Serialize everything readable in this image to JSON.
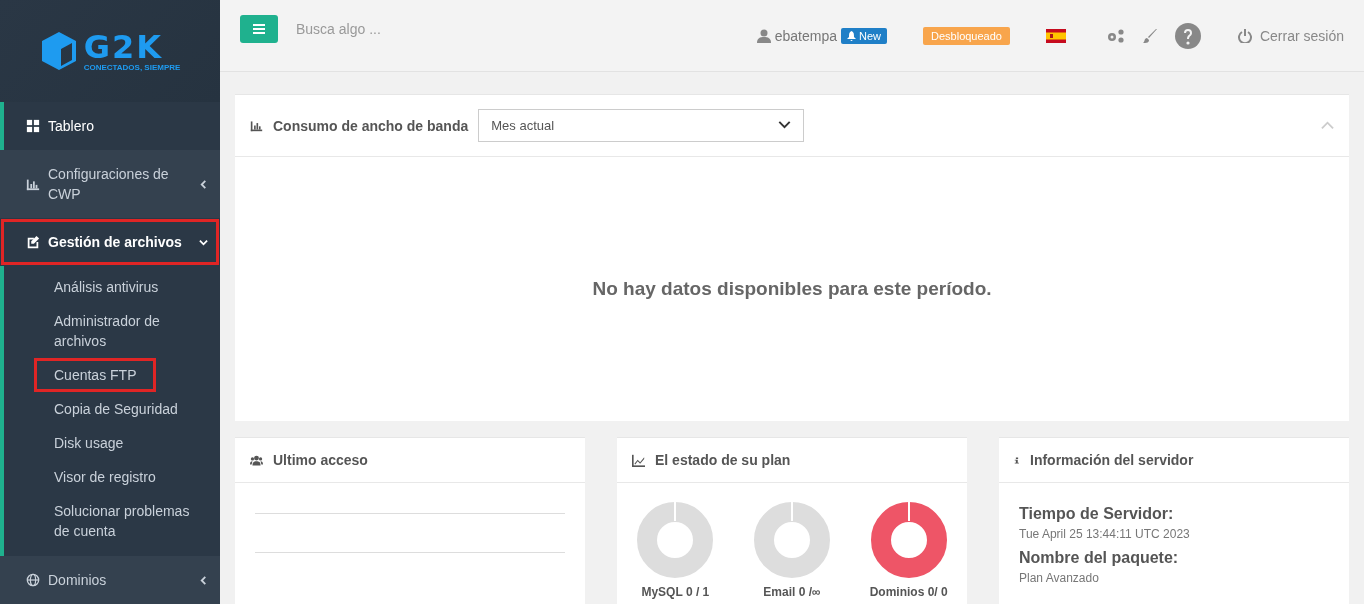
{
  "logo": {
    "wordmark": "G2K",
    "tagline": "CONECTADOS, SIEMPRE"
  },
  "sidebar": {
    "items": [
      {
        "label": "Tablero",
        "selected": true,
        "highlighted": false
      },
      {
        "label": "Configuraciones de CWP",
        "selected": false,
        "highlighted": false,
        "expanded": false
      },
      {
        "label": "Gestión de archivos",
        "selected": false,
        "highlighted": true,
        "expanded": true,
        "children": [
          {
            "label": "Análisis antivirus",
            "highlighted": false
          },
          {
            "label": "Administrador de archivos",
            "highlighted": false
          },
          {
            "label": "Cuentas FTP",
            "highlighted": true
          },
          {
            "label": "Copia de Seguridad",
            "highlighted": false
          },
          {
            "label": "Disk usage",
            "highlighted": false
          },
          {
            "label": "Visor de registro",
            "highlighted": false
          },
          {
            "label": "Solucionar problemas de cuenta",
            "highlighted": false
          }
        ]
      },
      {
        "label": "Dominios",
        "selected": false,
        "highlighted": false,
        "expanded": false
      }
    ]
  },
  "topbar": {
    "search": {
      "placeholder": "Busca algo ..."
    },
    "user": "ebatempa",
    "new_badge": "New",
    "status_badge": "Desbloqueado",
    "logout": "Cerrar sesión"
  },
  "bandwidth": {
    "title": "Consumo de ancho de banda",
    "period": "Mes actual",
    "empty_message": "No hay datos disponibles para este período."
  },
  "last_access": {
    "title": "Ultimo acceso"
  },
  "plan": {
    "title": "El estado de su plan",
    "gauges": [
      {
        "label": "MySQL 0 / 1",
        "color": "#dddddd"
      },
      {
        "label": "Email 0 /∞",
        "color": "#dddddd"
      },
      {
        "label": "Dominios 0/ 0",
        "color": "#ee5567"
      }
    ]
  },
  "server_info": {
    "title": "Información del servidor",
    "fields": [
      {
        "label": "Tiempo de Servidor:",
        "value": "Tue April 25 13:44:11 UTC 2023"
      },
      {
        "label": "Nombre del paquete:",
        "value": "Plan Avanzado"
      }
    ]
  }
}
